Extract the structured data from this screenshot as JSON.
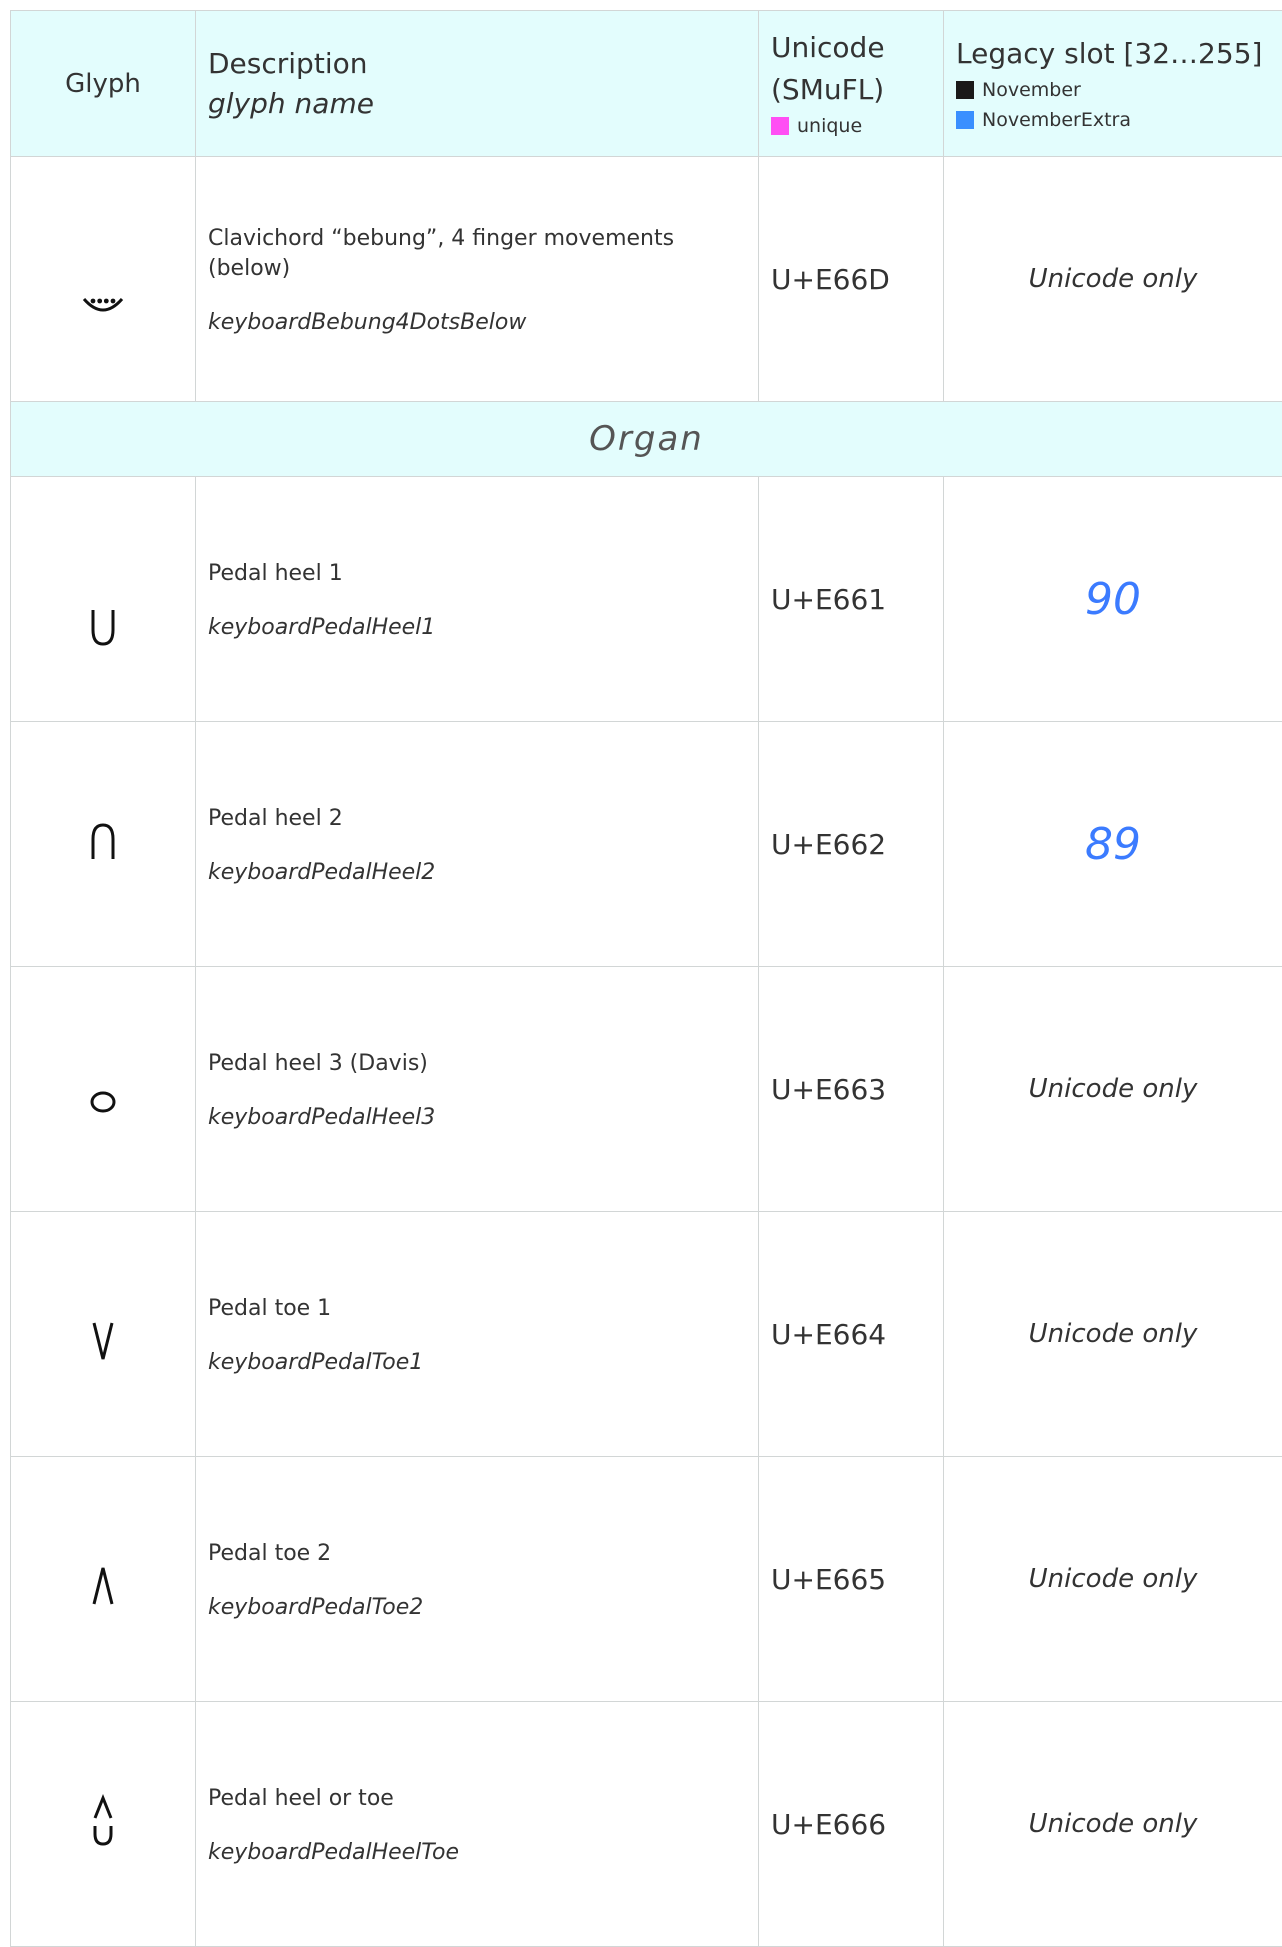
{
  "header": {
    "glyph": "Glyph",
    "description": "Description",
    "glyph_name": "glyph name",
    "unicode_line1": "Unicode",
    "unicode_line2": "(SMuFL)",
    "unique_label": "unique",
    "legacy": "Legacy slot [32…255]",
    "font1": "November",
    "font2": "NovemberExtra"
  },
  "colors": {
    "unique": "#ff4ff4",
    "november": "#1a1a1a",
    "november_extra": "#3a8fff",
    "header_bg": "#e3fdfd",
    "slot_text": "#3b7bff"
  },
  "rows_top": [
    {
      "icon": "keyboard-bebung-4-dots-below-icon",
      "description": "Clavichord “bebung”, 4 finger movements (below)",
      "name": "keyboardBebung4DotsBelow",
      "unicode": "U+E66D",
      "legacy": "Unicode only"
    }
  ],
  "section": "Organ",
  "rows": [
    {
      "icon": "pedal-heel-1-icon",
      "description": "Pedal heel 1",
      "name": "keyboardPedalHeel1",
      "unicode": "U+E661",
      "legacy": "90"
    },
    {
      "icon": "pedal-heel-2-icon",
      "description": "Pedal heel 2",
      "name": "keyboardPedalHeel2",
      "unicode": "U+E662",
      "legacy": "89"
    },
    {
      "icon": "pedal-heel-3-icon",
      "description": "Pedal heel 3 (Davis)",
      "name": "keyboardPedalHeel3",
      "unicode": "U+E663",
      "legacy": "Unicode only"
    },
    {
      "icon": "pedal-toe-1-icon",
      "description": "Pedal toe 1",
      "name": "keyboardPedalToe1",
      "unicode": "U+E664",
      "legacy": "Unicode only"
    },
    {
      "icon": "pedal-toe-2-icon",
      "description": "Pedal toe 2",
      "name": "keyboardPedalToe2",
      "unicode": "U+E665",
      "legacy": "Unicode only"
    },
    {
      "icon": "pedal-heel-or-toe-icon",
      "description": "Pedal heel or toe",
      "name": "keyboardPedalHeelToe",
      "unicode": "U+E666",
      "legacy": "Unicode only"
    }
  ]
}
